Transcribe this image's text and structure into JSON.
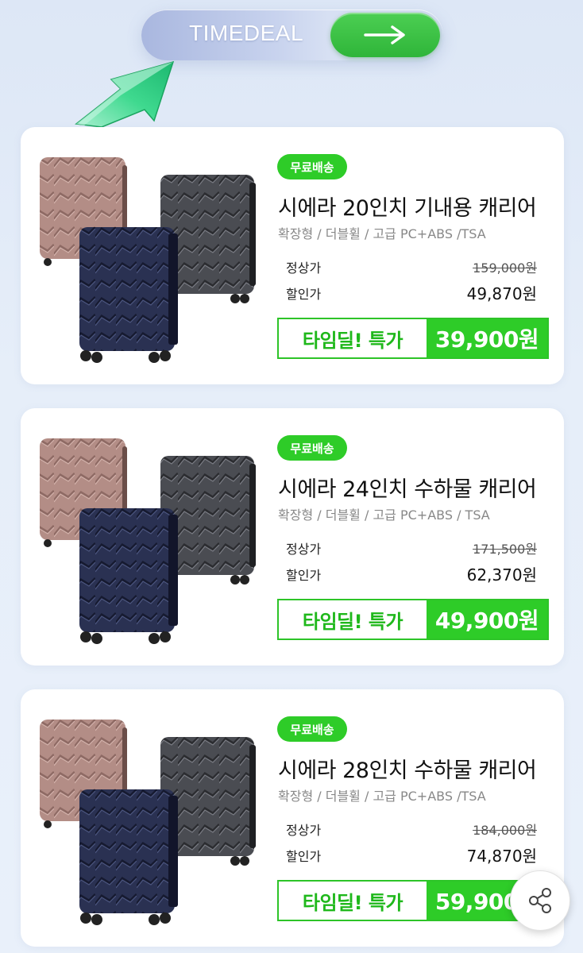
{
  "header": {
    "timedeal_label": "TIMEDEAL"
  },
  "colors": {
    "accent_green": "#2ecc28",
    "deal_text_green": "#1fb81b",
    "background": "#e6eef9"
  },
  "icons": {
    "go_button": "arrow-right-icon",
    "pointer": "big-3d-arrow-icon",
    "share": "share-icon"
  },
  "products": [
    {
      "badge": "무료배송",
      "title": "시에라 20인치 기내용 캐리어",
      "specs": "확장형 / 더블휠 / 고급 PC+ABS /TSA",
      "regular_label": "정상가",
      "regular_price": "159,000원",
      "discount_label": "할인가",
      "discount_price": "49,870원",
      "deal_label": "타임딜! 특가",
      "deal_price": "39,900원"
    },
    {
      "badge": "무료배송",
      "title": "시에라 24인치 수하물 캐리어",
      "specs": "확장형 / 더블휠 / 고급 PC+ABS / TSA",
      "regular_label": "정상가",
      "regular_price": "171,500원",
      "discount_label": "할인가",
      "discount_price": "62,370원",
      "deal_label": "타임딜! 특가",
      "deal_price": "49,900원"
    },
    {
      "badge": "무료배송",
      "title": "시에라 28인치 수하물 캐리어",
      "specs": "확장형 / 더블휠 / 고급 PC+ABS /TSA",
      "regular_label": "정상가",
      "regular_price": "184,000원",
      "discount_label": "할인가",
      "discount_price": "74,870원",
      "deal_label": "타임딜! 특가",
      "deal_price": "59,900원"
    }
  ]
}
